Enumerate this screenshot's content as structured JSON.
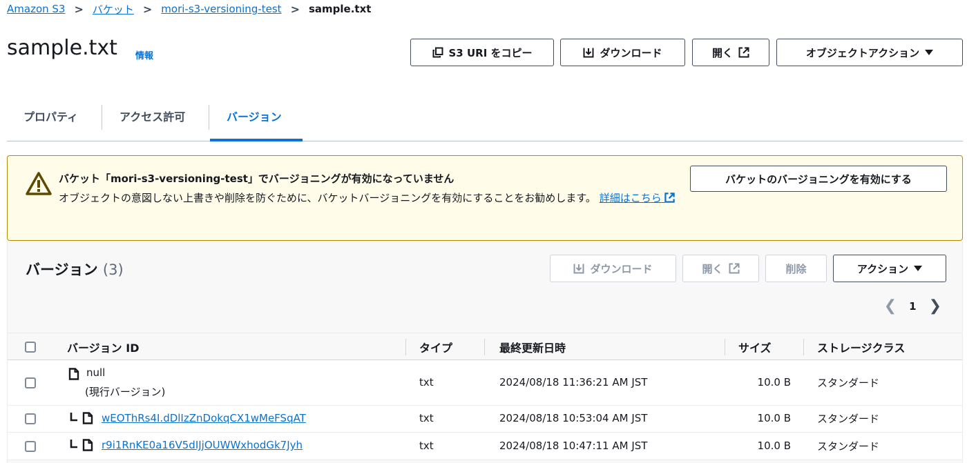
{
  "breadcrumb": [
    {
      "label": "Amazon S3"
    },
    {
      "label": "バケット"
    },
    {
      "label": "mori-s3-versioning-test"
    },
    {
      "label": "sample.txt"
    }
  ],
  "header": {
    "title": "sample.txt",
    "info": "情報",
    "buttons": {
      "copy_uri": "S3 URI をコピー",
      "download": "ダウンロード",
      "open": "開く",
      "object_actions": "オブジェクトアクション"
    }
  },
  "tabs": [
    {
      "label": "プロパティ"
    },
    {
      "label": "アクセス許可"
    },
    {
      "label": "バージョン"
    }
  ],
  "alert": {
    "title": "バケット「mori-s3-versioning-test」でバージョニングが有効になっていません",
    "body": "オブジェクトの意図しない上書きや削除を防ぐために、バケットバージョニングを有効にすることをお勧めします。",
    "link": "詳細はこちら",
    "button": "バケットのバージョニングを有効にする"
  },
  "versions": {
    "title": "バージョン",
    "count": "(3)",
    "buttons": {
      "download": "ダウンロード",
      "open": "開く",
      "delete": "削除",
      "actions": "アクション"
    },
    "page": "1",
    "columns": {
      "version_id": "バージョン ID",
      "type": "タイプ",
      "last_modified": "最終更新日時",
      "size": "サイズ",
      "storage_class": "ストレージクラス"
    },
    "rows": [
      {
        "version_id": "null",
        "note": "(現行バージョン)",
        "type": "txt",
        "last_modified": "2024/08/18 11:36:21 AM JST",
        "size": "10.0 B",
        "storage_class": "スタンダード"
      },
      {
        "version_id": "wEOThRs4I.dDlIzZnDokqCX1wMeFSqAT",
        "type": "txt",
        "last_modified": "2024/08/18 10:53:04 AM JST",
        "size": "10.0 B",
        "storage_class": "スタンダード"
      },
      {
        "version_id": "r9i1RnKE0a16V5dIJjOUWWxhodGk7Jyh",
        "type": "txt",
        "last_modified": "2024/08/18 10:47:11 AM JST",
        "size": "10.0 B",
        "storage_class": "スタンダード"
      }
    ]
  }
}
